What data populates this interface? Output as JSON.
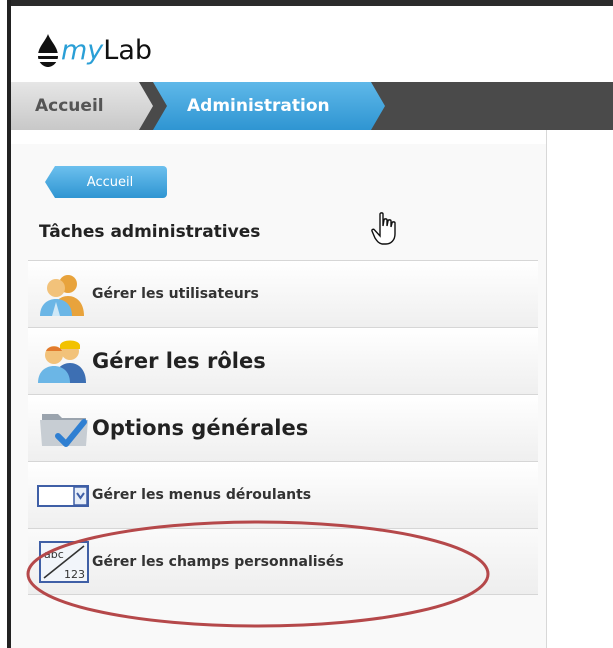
{
  "app": {
    "logo_my": "my",
    "logo_lab": "Lab"
  },
  "breadcrumb": {
    "home": "Accueil",
    "current": "Administration"
  },
  "page": {
    "back_button": "Accueil",
    "section_title": "Tâches administratives"
  },
  "menu": {
    "items": [
      {
        "label": "Gérer les utilisateurs",
        "icon": "users-icon"
      },
      {
        "label": "Gérer les rôles",
        "icon": "roles-icon"
      },
      {
        "label": "Options générales",
        "icon": "options-icon"
      },
      {
        "label": "Gérer les menus déroulants",
        "icon": "dropdown-icon"
      },
      {
        "label": "Gérer les champs personnalisés",
        "icon": "custom-fields-icon"
      }
    ]
  },
  "colors": {
    "accent_blue": "#2f95d2",
    "breadcrumb_dark": "#4a4a4a",
    "highlight_red": "#b5484a"
  }
}
